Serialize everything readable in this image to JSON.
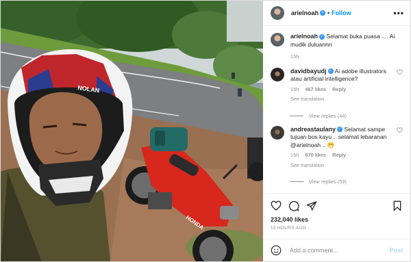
{
  "header": {
    "username": "arielnoah",
    "verified": true,
    "separator": "•",
    "follow_label": "Follow",
    "more_icon": "more-horizontal-icon"
  },
  "caption": {
    "username": "arielnoah",
    "text": "Selamat buka puasa .... Ai mudik duluannn",
    "time": "15h"
  },
  "comments": [
    {
      "username": "davidbayudj",
      "text": "Ai adobe illustrators atau artificial intelligence?",
      "time": "15h",
      "likes": "467 likes",
      "reply": "Reply",
      "see_translation": "See translation",
      "view_replies": "View replies (44)"
    },
    {
      "username": "andreastaulany",
      "text": "Selamat sampe tujuan bos kayu .. selamat lebaranan @arielnoah .. 😁",
      "time": "15h",
      "likes": "670 likes",
      "reply": "Reply",
      "see_translation": "See translation",
      "view_replies": "View replies (59)"
    }
  ],
  "actions": {
    "icons": [
      "heart-icon",
      "comment-icon",
      "share-icon",
      "bookmark-icon"
    ],
    "likes": "232,040 likes",
    "timestamp": "15 HOURS AGO"
  },
  "add_comment": {
    "placeholder": "Add a comment...",
    "post_label": "Post",
    "emoji_icon": "emoji-icon"
  },
  "colors": {
    "link": "#0095f6",
    "verified": "#3897f0",
    "secondary_text": "#8e8e8e",
    "post_disabled": "#b3dbff",
    "motorcycle": "#d8271d"
  },
  "photo": {
    "helmet_brand": "NOLAN",
    "bike_brand": "HONDA"
  }
}
